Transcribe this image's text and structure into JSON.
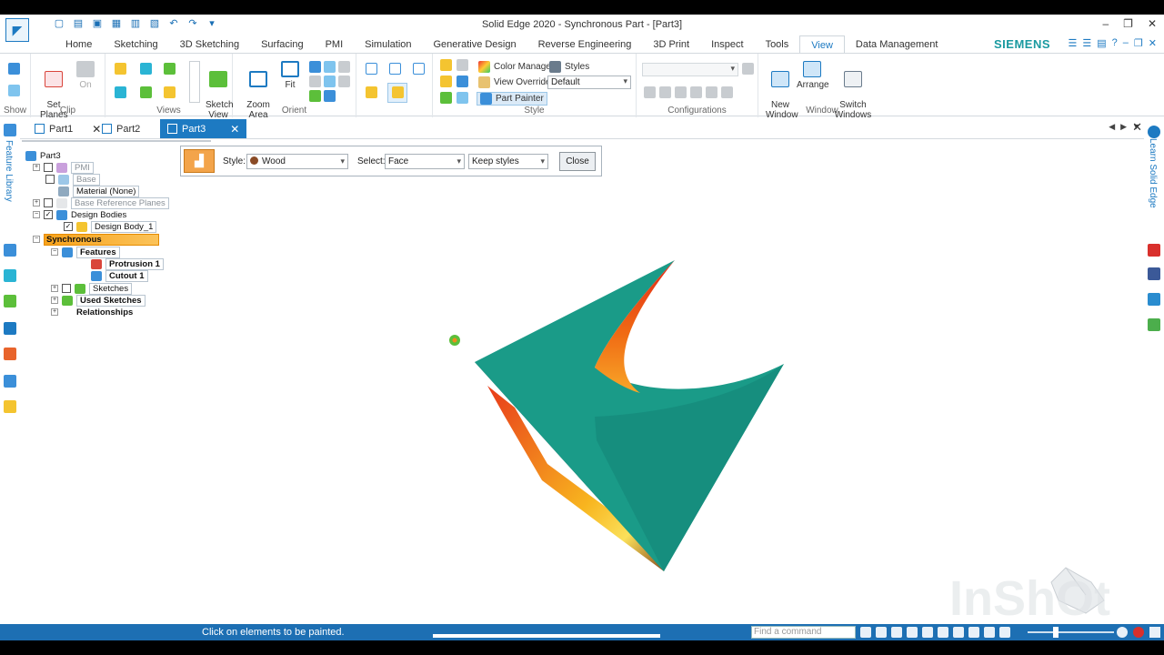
{
  "window": {
    "title": "Solid Edge 2020 - Synchronous Part - [Part3]",
    "controls": [
      "–",
      "❐",
      "✕"
    ]
  },
  "ribbon_tabs": [
    {
      "label": "Home"
    },
    {
      "label": "Sketching"
    },
    {
      "label": "3D Sketching"
    },
    {
      "label": "Surfacing"
    },
    {
      "label": "PMI"
    },
    {
      "label": "Simulation"
    },
    {
      "label": "Generative Design"
    },
    {
      "label": "Reverse Engineering"
    },
    {
      "label": "3D Print"
    },
    {
      "label": "Inspect"
    },
    {
      "label": "Tools"
    },
    {
      "label": "View"
    },
    {
      "label": "Data Management"
    }
  ],
  "active_tab": "View",
  "brand": "SIEMENS",
  "ribbon": {
    "show_label": "Show",
    "clip": {
      "set_planes": "Set\nPlanes",
      "on": "On",
      "label": "Clip"
    },
    "views_label": "Views",
    "sketch_view": "Sketch\nView",
    "orient": {
      "zoom_area": "Zoom\nArea",
      "fit": "Fit",
      "label": "Orient"
    },
    "style": {
      "color_manager": "Color Manager",
      "styles": "Styles",
      "view_overrides": "View Overrides",
      "view_overrides_value": "Default",
      "part_painter": "Part Painter",
      "label": "Style"
    },
    "configurations_label": "Configurations",
    "window": {
      "new_window": "New\nWindow",
      "arrange": "Arrange",
      "switch_windows": "Switch\nWindows",
      "label": "Window"
    }
  },
  "doc_tabs": [
    {
      "label": "Part1",
      "active": false
    },
    {
      "label": "Part2",
      "active": false
    },
    {
      "label": "Part3",
      "active": true
    }
  ],
  "left_panel": {
    "title": "Feature Library"
  },
  "right_panel": {
    "title": "Learn Solid Edge"
  },
  "tree": {
    "root": "Part3",
    "pmi": "PMI",
    "base": "Base",
    "material": "Material (None)",
    "base_ref_planes": "Base Reference Planes",
    "design_bodies": "Design Bodies",
    "design_body_1": "Design Body_1",
    "synchronous": "Synchronous",
    "features": "Features",
    "protrusion": "Protrusion 1",
    "cutout": "Cutout 1",
    "sketches": "Sketches",
    "used_sketches": "Used Sketches",
    "relationships": "Relationships"
  },
  "command_bar": {
    "style_label": "Style:",
    "style_value": "Wood",
    "select_label": "Select:",
    "select_value": "Face",
    "keep_value": "Keep styles",
    "close_label": "Close"
  },
  "status": {
    "prompt": "Click on elements to be painted.",
    "find_placeholder": "Find a command"
  },
  "watermark": "InShOt",
  "colors": {
    "accent": "#1d7ac2",
    "part_face": "#1a9b88",
    "part_face_dark": "#158574",
    "cut_face_orange": "#f08a1c",
    "cut_face_red": "#e2301a",
    "siemens": "#1a9aa0",
    "statusbar": "#1d6fb3"
  }
}
